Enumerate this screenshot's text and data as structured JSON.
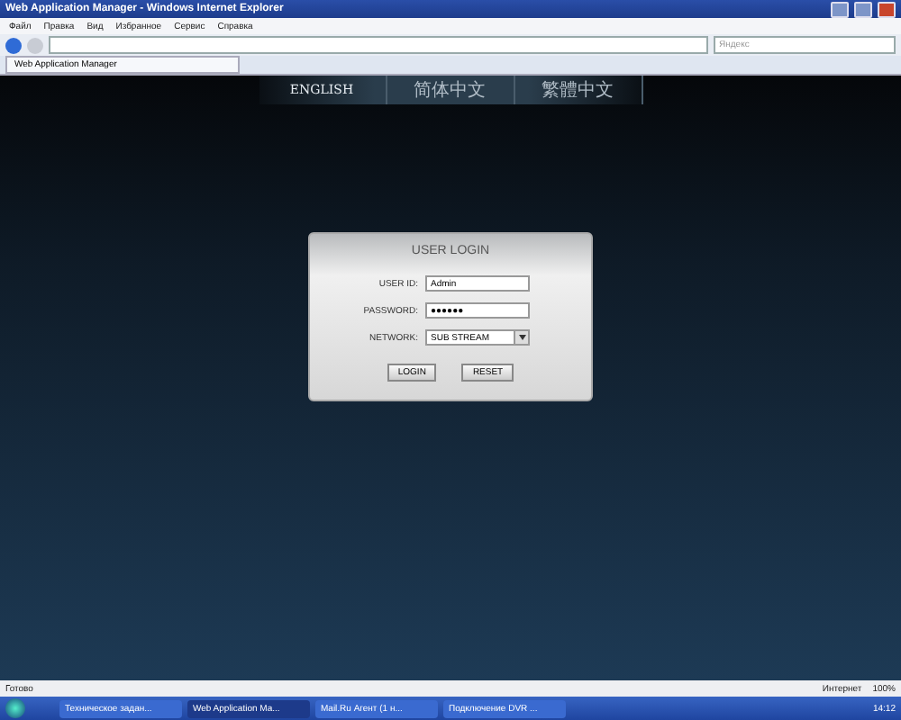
{
  "window": {
    "title": "Web Application Manager - Windows Internet Explorer"
  },
  "menu": [
    "Файл",
    "Правка",
    "Вид",
    "Избранное",
    "Сервис",
    "Справка"
  ],
  "search": {
    "placeholder": "Яндекс"
  },
  "tab": {
    "label": "Web Application Manager"
  },
  "languages": [
    {
      "label": "ENGLISH",
      "selected": true
    },
    {
      "label": "简体中文",
      "selected": false
    },
    {
      "label": "繁體中文",
      "selected": false
    }
  ],
  "login": {
    "title": "USER LOGIN",
    "user_label": "USER ID:",
    "user_value": "Admin",
    "password_label": "PASSWORD:",
    "password_value": "●●●●●●",
    "network_label": "NETWORK:",
    "network_value": "SUB STREAM",
    "buttons": [
      "LOGIN",
      "RESET"
    ]
  },
  "status_bar": {
    "status": "Готово",
    "zone": "Интернет",
    "zoom": "100%"
  },
  "taskbar": {
    "items": [
      {
        "label": "Техническое задан...",
        "selected": false
      },
      {
        "label": "Web Application Ma...",
        "selected": true
      },
      {
        "label": "Mail.Ru Агент (1 н...",
        "selected": false
      },
      {
        "label": "Подключение DVR ...",
        "selected": false
      }
    ],
    "clock": "14:12"
  }
}
